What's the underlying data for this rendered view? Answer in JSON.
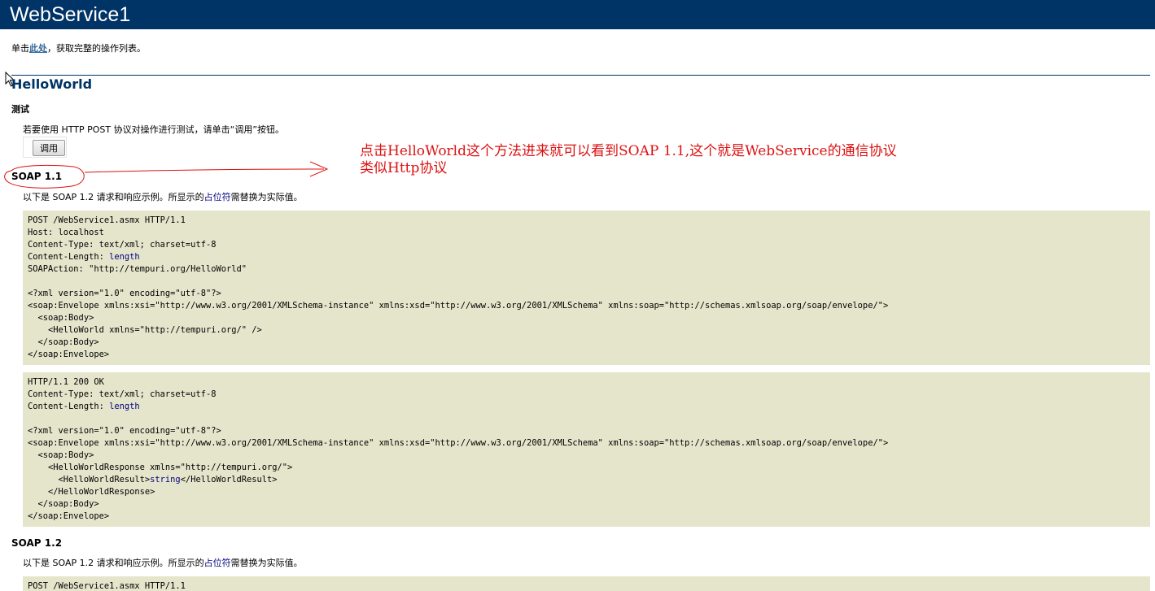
{
  "header": {
    "title": "WebService1"
  },
  "intro": {
    "prefix": "单击",
    "link": "此处",
    "suffix": "，获取完整的操作列表。"
  },
  "operation": {
    "name": "HelloWorld",
    "test": {
      "heading": "测试",
      "description": "若要使用 HTTP POST 协议对操作进行测试，请单击“调用”按钮。",
      "invoke_label": "调用"
    }
  },
  "annotation": {
    "line1": "点击HelloWorld这个方法进来就可以看到SOAP 1.1,这个就是WebService的通信协议",
    "line2": "类似Http协议",
    "color": "#dd1111"
  },
  "soap11": {
    "heading": "SOAP 1.1",
    "desc_prefix": "以下是 SOAP 1.2 请求和响应示例。所显示的",
    "placeholder_word": "占位符",
    "desc_suffix": "需替换为实际值。",
    "request": [
      "POST /WebService1.asmx HTTP/1.1",
      "Host: localhost",
      "Content-Type: text/xml; charset=utf-8",
      "Content-Length: ",
      "length",
      "SOAPAction: \"http://tempuri.org/HelloWorld\"",
      "",
      "<?xml version=\"1.0\" encoding=\"utf-8\"?>",
      "<soap:Envelope xmlns:xsi=\"http://www.w3.org/2001/XMLSchema-instance\" xmlns:xsd=\"http://www.w3.org/2001/XMLSchema\" xmlns:soap=\"http://schemas.xmlsoap.org/soap/envelope/\">",
      "  <soap:Body>",
      "    <HelloWorld xmlns=\"http://tempuri.org/\" />",
      "  </soap:Body>",
      "</soap:Envelope>"
    ],
    "response": [
      "HTTP/1.1 200 OK",
      "Content-Type: text/xml; charset=utf-8",
      "Content-Length: ",
      "length",
      "",
      "<?xml version=\"1.0\" encoding=\"utf-8\"?>",
      "<soap:Envelope xmlns:xsi=\"http://www.w3.org/2001/XMLSchema-instance\" xmlns:xsd=\"http://www.w3.org/2001/XMLSchema\" xmlns:soap=\"http://schemas.xmlsoap.org/soap/envelope/\">",
      "  <soap:Body>",
      "    <HelloWorldResponse xmlns=\"http://tempuri.org/\">",
      "      <HelloWorldResult>",
      "string",
      "</HelloWorldResult>",
      "    </HelloWorldResponse>",
      "  </soap:Body>",
      "</soap:Envelope>"
    ]
  },
  "soap12": {
    "heading": "SOAP 1.2",
    "desc_prefix": "以下是 SOAP 1.2 请求和响应示例。所显示的",
    "placeholder_word": "占位符",
    "desc_suffix": "需替换为实际值。",
    "request_first_line": "POST /WebService1.asmx HTTP/1.1"
  },
  "colors": {
    "header_bg": "#003366",
    "link": "#336699",
    "code_bg": "#e5e5cc",
    "placeholder": "#000080",
    "annotation_red": "#dd1111"
  }
}
